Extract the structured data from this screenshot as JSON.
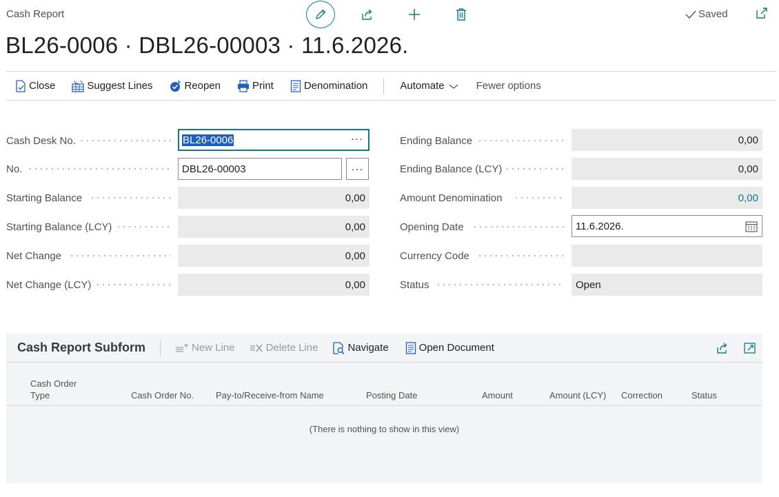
{
  "page": {
    "caption": "Cash Report",
    "title": "BL26-0006 · DBL26-00003 · 11.6.2026.",
    "saved_label": "Saved"
  },
  "actions": {
    "close": "Close",
    "suggest_lines": "Suggest Lines",
    "reopen": "Reopen",
    "print": "Print",
    "denomination": "Denomination",
    "automate": "Automate",
    "fewer_options": "Fewer options"
  },
  "fields_left": [
    {
      "label": "Cash Desk No.",
      "value": "BL26-0006"
    },
    {
      "label": "No.",
      "value": "DBL26-00003"
    },
    {
      "label": "Starting Balance",
      "value": "0,00"
    },
    {
      "label": "Starting Balance (LCY)",
      "value": "0,00"
    },
    {
      "label": "Net Change",
      "value": "0,00"
    },
    {
      "label": "Net Change (LCY)",
      "value": "0,00"
    }
  ],
  "fields_right": [
    {
      "label": "Ending Balance",
      "value": "0,00"
    },
    {
      "label": "Ending Balance (LCY)",
      "value": "0,00"
    },
    {
      "label": "Amount Denomination",
      "value": "0,00"
    },
    {
      "label": "Opening Date",
      "value": "11.6.2026."
    },
    {
      "label": "Currency Code",
      "value": ""
    },
    {
      "label": "Status",
      "value": "Open"
    }
  ],
  "ellipsis": "···",
  "subform": {
    "title": "Cash Report Subform",
    "new_line": "New Line",
    "delete_line": "Delete Line",
    "navigate": "Navigate",
    "open_document": "Open Document",
    "columns": [
      {
        "line1": "Cash Order",
        "line2": "Type"
      },
      {
        "line1": "",
        "line2": "Cash Order No."
      },
      {
        "line1": "",
        "line2": "Pay-to/Receive-from Name"
      },
      {
        "line1": "",
        "line2": "Posting Date"
      },
      {
        "line1": "",
        "line2": "Amount"
      },
      {
        "line1": "",
        "line2": "Amount (LCY)"
      },
      {
        "line1": "",
        "line2": "Correction"
      },
      {
        "line1": "",
        "line2": "Status"
      }
    ],
    "empty_message": "(There is nothing to show in this view)"
  },
  "icons": {
    "edit": "pencil-icon",
    "share": "share-icon",
    "new": "plus-icon",
    "delete": "trash-icon",
    "saved": "check-icon",
    "popout": "popout-icon",
    "calendar": "calendar-icon"
  },
  "colors": {
    "accent": "#0e7c86",
    "selection": "#1f5fbf",
    "readonly_bg": "#eaeaea",
    "subform_bg": "#f3f4f6"
  }
}
